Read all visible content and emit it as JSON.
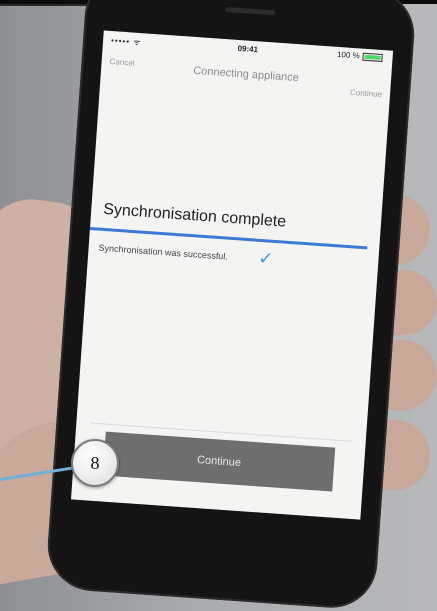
{
  "status_bar": {
    "signal": "••••• ᯤ",
    "time": "09:41",
    "battery": "100 %"
  },
  "nav": {
    "cancel": "Cancel",
    "title": "Connecting appliance",
    "continue": "Continue"
  },
  "content": {
    "heading": "Synchronisation complete",
    "message": "Synchronisation was successful.",
    "check_symbol": "✓"
  },
  "footer": {
    "continue_button": "Continue"
  },
  "annotation": {
    "number": "8"
  },
  "colors": {
    "accent": "#3a7bd5",
    "button": "#6e6e6e",
    "battery": "#4cd964"
  }
}
